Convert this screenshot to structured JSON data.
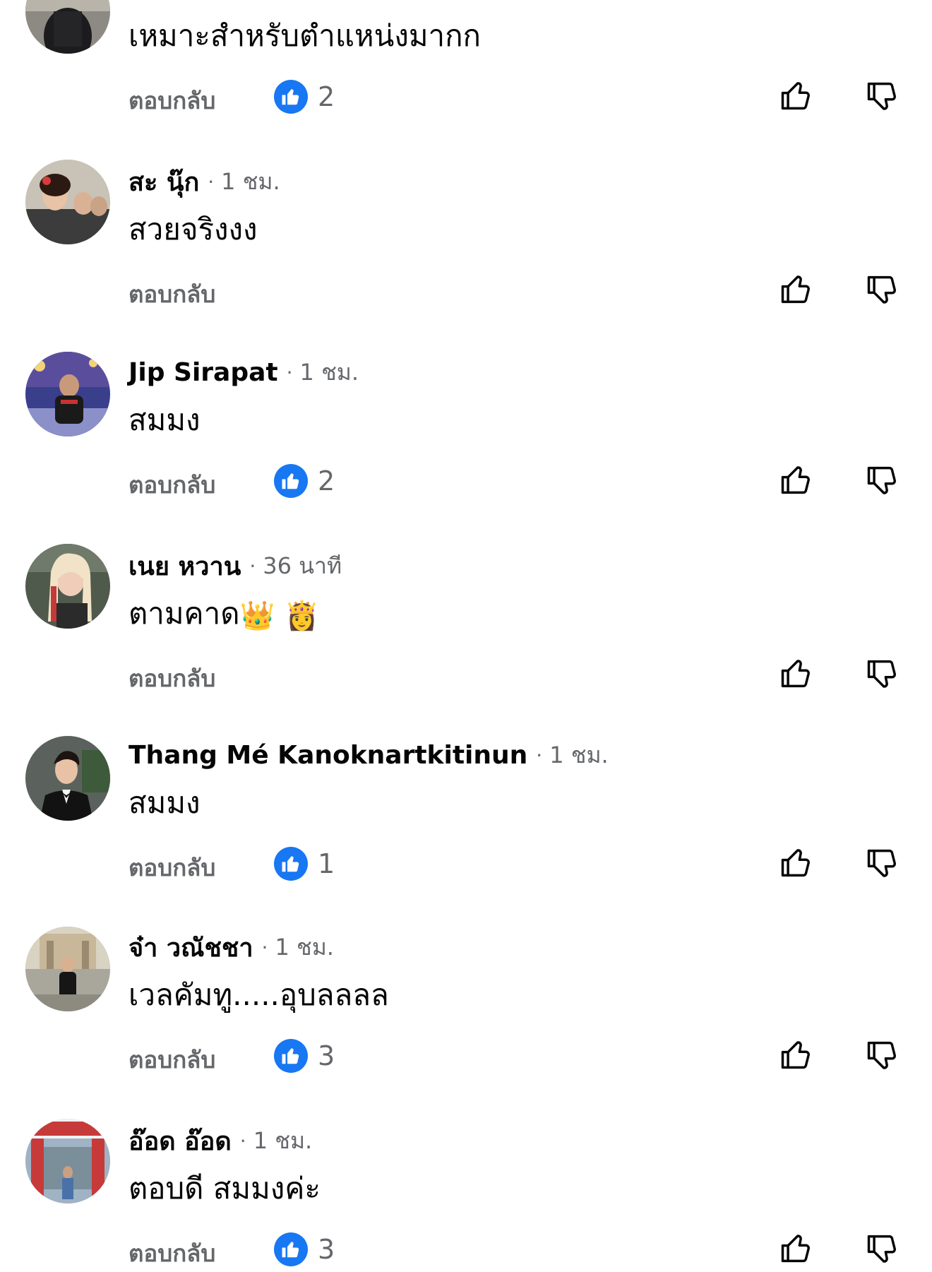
{
  "reply_label": "ตอบกลับ",
  "separator": "·",
  "colors": {
    "like_badge": "#1877f2",
    "secondary_text": "#65676b",
    "primary_text": "#050505"
  },
  "comments": [
    {
      "name": "",
      "time": "",
      "text": "เหมาะสำหรับตำแหน่งมากก",
      "likes": "2"
    },
    {
      "name": "สะ นุ๊ก",
      "time": "1 ชม.",
      "text": "สวยจริงงง",
      "likes": ""
    },
    {
      "name": "Jip Sirapat",
      "time": "1 ชม.",
      "text": "สมมง",
      "likes": "2"
    },
    {
      "name": "เนย หวาน",
      "time": "36 นาที",
      "text": "ตามคาด",
      "emojis": [
        "👑",
        "👸"
      ],
      "likes": ""
    },
    {
      "name": "Thang Mé Kanoknartkitinun",
      "time": "1 ชม.",
      "text": "สมมง",
      "likes": "1"
    },
    {
      "name": "จ๋า วณัชชา",
      "time": "1 ชม.",
      "text": "เวลคัมทู.....อุบลลลล",
      "likes": "3"
    },
    {
      "name": "อ๊อด อ๊อด",
      "time": "1 ชม.",
      "text": "ตอบดี สมมงค่ะ",
      "likes": "3"
    }
  ],
  "icons": {
    "like_badge": "thumbs-up-filled-icon",
    "upvote": "thumbs-up-outline-icon",
    "downvote": "thumbs-down-outline-icon"
  }
}
